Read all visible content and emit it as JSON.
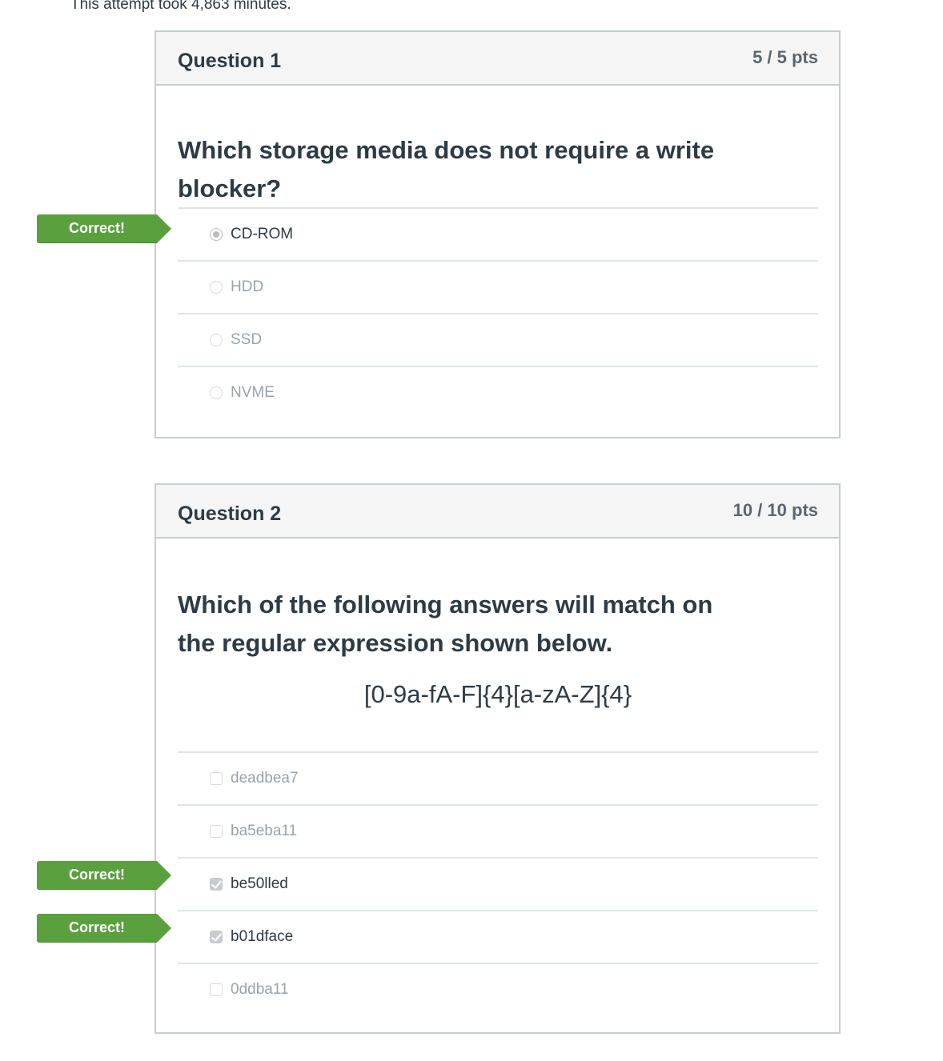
{
  "attempt_text": "This attempt took 4,863 minutes.",
  "colors": {
    "correct_flag": "#5aa03f",
    "text": "#2d3b45",
    "muted": "#9aa3aa"
  },
  "correct_label": "Correct!",
  "questions": [
    {
      "title": "Question 1",
      "points": "5 / 5 pts",
      "text": "Which storage media does not require a write blocker?",
      "input_type": "radio",
      "answers": [
        {
          "label": "CD-ROM",
          "selected": true,
          "correct": true
        },
        {
          "label": "HDD",
          "selected": false,
          "correct": false
        },
        {
          "label": "SSD",
          "selected": false,
          "correct": false
        },
        {
          "label": "NVME",
          "selected": false,
          "correct": false
        }
      ]
    },
    {
      "title": "Question 2",
      "points": "10 / 10 pts",
      "text": "Which of the following answers will match on the regular expression shown below.",
      "regex": "[0-9a-fA-F]{4}[a-zA-Z]{4}",
      "input_type": "checkbox",
      "answers": [
        {
          "label": "deadbea7",
          "selected": false,
          "correct": false
        },
        {
          "label": "ba5eba11",
          "selected": false,
          "correct": false
        },
        {
          "label": "be50lled",
          "selected": true,
          "correct": true
        },
        {
          "label": "b01dface",
          "selected": true,
          "correct": true
        },
        {
          "label": "0ddba11",
          "selected": false,
          "correct": false
        }
      ]
    }
  ]
}
